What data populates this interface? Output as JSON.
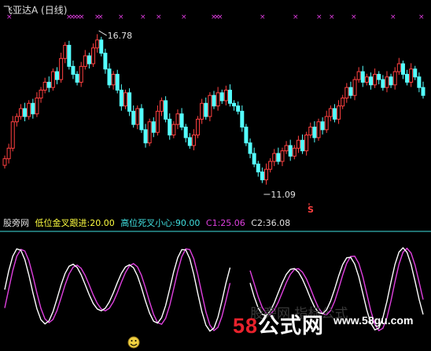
{
  "main": {
    "title": "飞亚达A (日线)",
    "high_label": "16.78",
    "low_label": "11.09",
    "signal_label": "S"
  },
  "indicator": {
    "name": "股旁网",
    "low_cross_label": "低位金叉跟进:20.00",
    "high_cross_label": "高位死叉小心:90.00",
    "c1_label": "C1:25.06",
    "c2_label": "C2:36.08"
  },
  "watermark": {
    "brand_num": "58",
    "brand_text": "公式网",
    "url": "www.58gu.com",
    "faint": "股旁网 指标公式"
  },
  "colors": {
    "up": "#ff4040",
    "down": "#54ffff",
    "cross_marker": "#e03ce0",
    "line_white": "#ffffff",
    "line_magenta": "#e040e0",
    "title_yellow": "#ffff40",
    "title_cyan": "#40e0e0",
    "title_magenta": "#e040e0",
    "title_white": "#e0e0e0",
    "separator": "#4040ff"
  },
  "chart_data": {
    "type": "candlestick",
    "ylim": [
      10.5,
      17.3
    ],
    "close": [
      12.0,
      12.4,
      13.4,
      13.6,
      13.9,
      13.6,
      14.1,
      13.7,
      14.3,
      14.6,
      14.9,
      14.7,
      15.3,
      15.0,
      15.8,
      16.3,
      15.5,
      15.2,
      14.9,
      15.5,
      15.9,
      15.6,
      16.2,
      16.5,
      16.0,
      15.4,
      14.8,
      15.2,
      14.6,
      14.0,
      14.5,
      13.8,
      13.3,
      13.9,
      13.1,
      12.6,
      13.4,
      13.0,
      13.8,
      14.2,
      13.5,
      12.9,
      13.3,
      13.7,
      13.2,
      12.8,
      12.5,
      12.9,
      13.5,
      14.1,
      13.6,
      14.4,
      14.0,
      14.5,
      14.2,
      14.6,
      14.1,
      14.0,
      13.8,
      13.2,
      12.6,
      12.2,
      11.8,
      11.5,
      11.2,
      11.6,
      11.9,
      12.2,
      11.9,
      12.3,
      12.5,
      12.1,
      12.4,
      12.7,
      12.3,
      12.9,
      13.2,
      12.8,
      13.4,
      13.1,
      13.6,
      13.9,
      13.5,
      14.0,
      14.3,
      14.7,
      14.4,
      15.0,
      15.3,
      14.9,
      15.1,
      14.8,
      15.2,
      15.0,
      14.7,
      15.1,
      14.8,
      15.3,
      15.6,
      15.2,
      14.9,
      15.4,
      15.1,
      14.7,
      14.4
    ]
  }
}
